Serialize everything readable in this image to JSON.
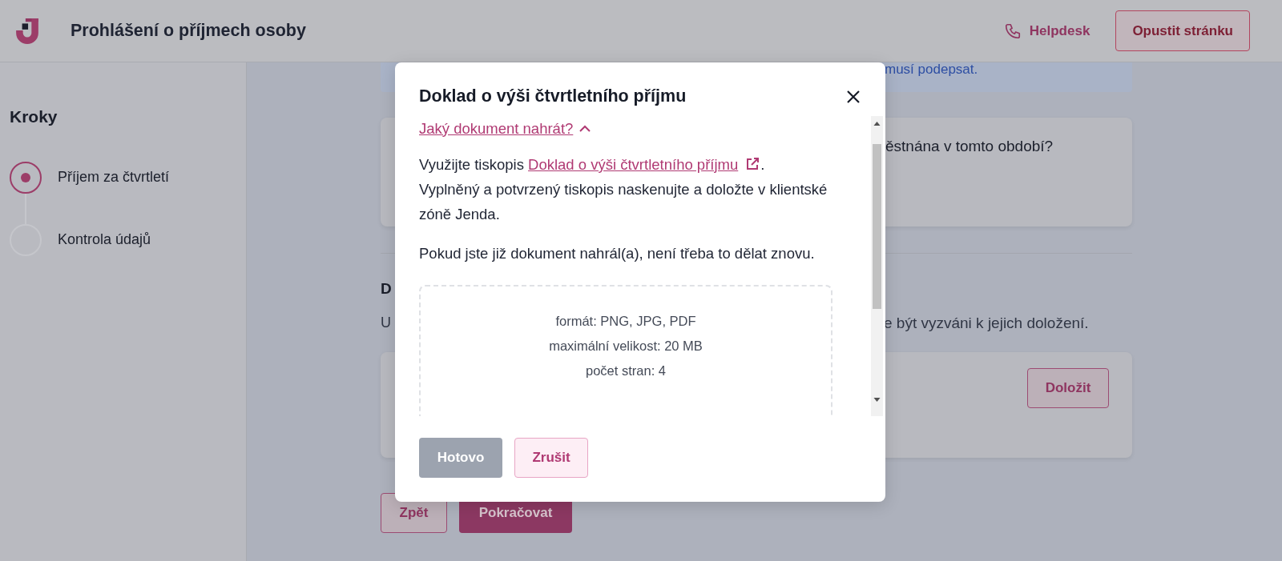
{
  "header": {
    "title": "Prohlášení o příjmech osoby",
    "helpdesk": "Helpdesk",
    "leave_button": "Opustit stránku"
  },
  "sidebar": {
    "title": "Kroky",
    "steps": [
      {
        "label": "Příjem za čtvrtletí",
        "selected": true
      },
      {
        "label": "Kontrola údajů",
        "selected": false
      }
    ]
  },
  "background": {
    "alert_text": "musí podepsat.",
    "question": "ěstnána v tomto období?",
    "heading": "D",
    "text_start": "U",
    "text_end": "e být vyzváni k jejich doložení.",
    "attach_button": "Doložit",
    "back_button": "Zpět",
    "continue_button": "Pokračovat"
  },
  "dialog": {
    "title": "Doklad o výši čtvrtletního příjmu",
    "toggle_link": "Jaký dokument nahrát?",
    "expanded": true,
    "intro_before": "Využijte tiskopis ",
    "form_link": "Doklad o výši čtvrtletního příjmu",
    "intro_after": ".",
    "intro_rest": "Vyplněný a potvrzený tiskopis naskenujte a doložte v klientské zóně Jenda.",
    "note": "Pokud jste již dokument nahrál(a), není třeba to dělat znovu.",
    "dropzone_lines": [
      "formát: PNG, JPG, PDF",
      "maximální velikost: 20 MB",
      "počet stran: 4"
    ],
    "done_button": {
      "label": "Hotovo",
      "disabled": true
    },
    "cancel_button": "Zrušit"
  }
}
